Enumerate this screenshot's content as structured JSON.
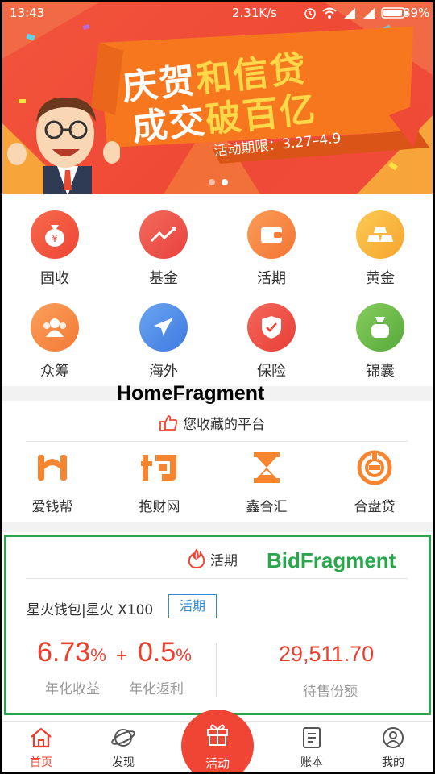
{
  "status_bar": {
    "time": "13:43",
    "network_speed": "2.31K/s",
    "battery": "89%",
    "icons": [
      "alarm-icon",
      "wifi-icon",
      "signal-icon",
      "signal-icon",
      "battery-icon"
    ]
  },
  "banner": {
    "title_line1_white": "庆贺",
    "title_line1_highlight": "和信贷",
    "title_line2_white": "成交",
    "title_line2_highlight": "破百亿",
    "period": "活动期限：3.27–4.9",
    "page_count": 2,
    "active_page": 2
  },
  "categories": [
    {
      "label": "固收",
      "icon": "money-bag-icon",
      "color": "#f0513b"
    },
    {
      "label": "基金",
      "icon": "trend-line-icon",
      "color": "#ef4b43"
    },
    {
      "label": "活期",
      "icon": "wallet-icon",
      "color": "#f7833f"
    },
    {
      "label": "黄金",
      "icon": "gold-bars-icon",
      "color": "#f8b238"
    },
    {
      "label": "众筹",
      "icon": "people-icon",
      "color": "#f78a3c"
    },
    {
      "label": "海外",
      "icon": "airplane-icon",
      "color": "#4f8bea"
    },
    {
      "label": "保险",
      "icon": "shield-check-icon",
      "color": "#ee4a3d"
    },
    {
      "label": "锦囊",
      "icon": "pouch-icon",
      "color": "#6bbc49"
    }
  ],
  "annotations": {
    "home_fragment": "HomeFragment",
    "bid_fragment": "BidFragment"
  },
  "favorites": {
    "title": "您收藏的平台",
    "icon": "thumbs-up-icon",
    "platforms": [
      {
        "label": "爱钱帮",
        "icon": "aiqianbang-logo-icon"
      },
      {
        "label": "抱财网",
        "icon": "baocai-logo-icon"
      },
      {
        "label": "鑫合汇",
        "icon": "xinhehui-logo-icon"
      },
      {
        "label": "合盘贷",
        "icon": "hepandai-logo-icon"
      }
    ],
    "accent": "#f7852f"
  },
  "bid": {
    "section_title": "活期",
    "section_icon": "flame-icon",
    "product_name": "星火钱包|星火 X100",
    "product_tag": "活期",
    "annual_rate": "6.73",
    "annual_rate_unit": "%",
    "plus_sign": "+",
    "rebate_rate": "0.5",
    "rebate_rate_unit": "%",
    "annual_rate_label": "年化收益",
    "rebate_label": "年化返利",
    "amount": "29,511.70",
    "amount_label": "待售份额",
    "accent": "#f03d2b"
  },
  "tabbar": {
    "tabs": [
      {
        "label": "首页",
        "icon": "home-icon",
        "active": true
      },
      {
        "label": "发现",
        "icon": "planet-icon",
        "active": false
      },
      {
        "label": "活动",
        "icon": "gift-icon",
        "active": false
      },
      {
        "label": "账本",
        "icon": "ledger-icon",
        "active": false
      },
      {
        "label": "我的",
        "icon": "user-icon",
        "active": false
      }
    ]
  }
}
